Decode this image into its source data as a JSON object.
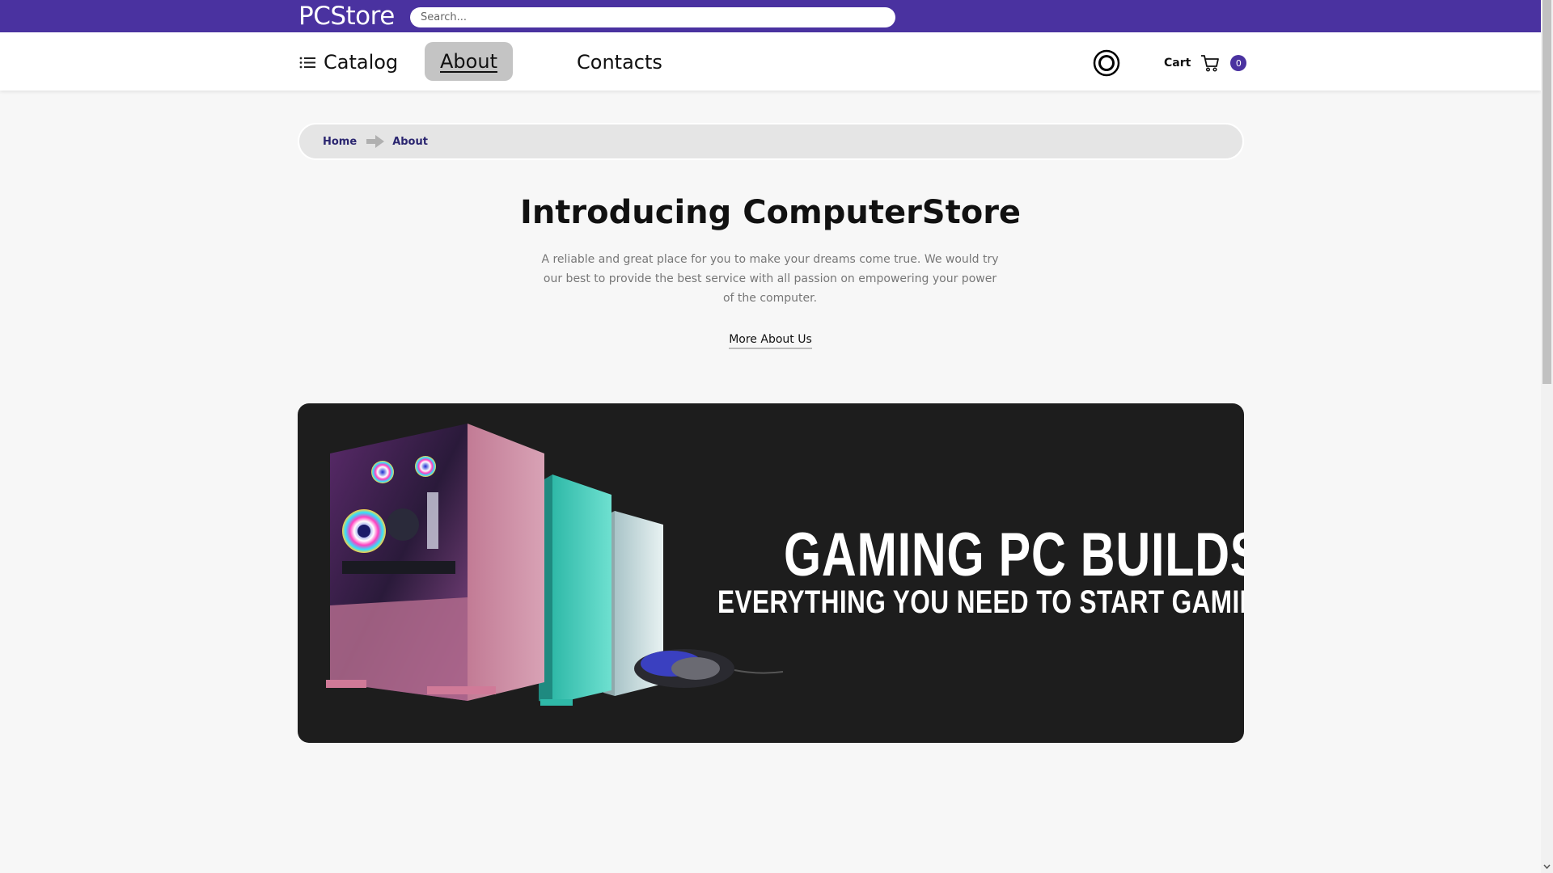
{
  "header": {
    "logo": "PCStore",
    "search": {
      "placeholder": "Search...",
      "value": ""
    },
    "brand_color": "#4a32a0"
  },
  "nav": {
    "catalog_label": "Catalog",
    "about_label": "About",
    "contacts_label": "Contacts",
    "active_item": "About",
    "user_icon": "user-circle-icon",
    "cart_label": "Cart",
    "cart_icon": "shopping-cart-icon",
    "cart_count": "0"
  },
  "breadcrumb": {
    "items": [
      {
        "label": "Home"
      },
      {
        "label": "About"
      }
    ],
    "separator_icon": "arrow-right-icon"
  },
  "intro": {
    "title": "Introducing ComputerStore",
    "text": "A reliable and great place for you to make your dreams come true. We would try our best to provide the best service with all passion on empowering your power of the computer.",
    "more_link": "More About Us"
  },
  "banner": {
    "title": "GAMING PC BUILDS",
    "subtitle": "EVERYTHING YOU NEED TO START GAMING",
    "background_color": "#1d1d1d"
  }
}
